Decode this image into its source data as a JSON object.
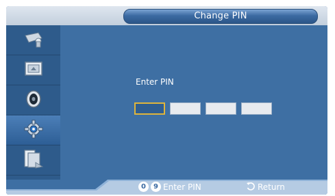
{
  "title": "Change PIN",
  "main": {
    "enter_pin_label": "Enter PIN",
    "pin_digit_count": 4,
    "active_box_index": 0
  },
  "sidebar": {
    "items": [
      {
        "icon": "input-source-icon"
      },
      {
        "icon": "picture-icon"
      },
      {
        "icon": "sound-icon"
      },
      {
        "icon": "setup-gear-icon",
        "active": true
      },
      {
        "icon": "multi-control-icon"
      }
    ]
  },
  "footer": {
    "key0": "0",
    "key9": "9",
    "enter_pin_hint": "Enter PIN",
    "return_label": "Return"
  },
  "colors": {
    "background": "#3e6fa3",
    "sidebar": "#2e5b8b",
    "active_box_border": "#e0b53a",
    "title_bar": "#2c5688"
  }
}
